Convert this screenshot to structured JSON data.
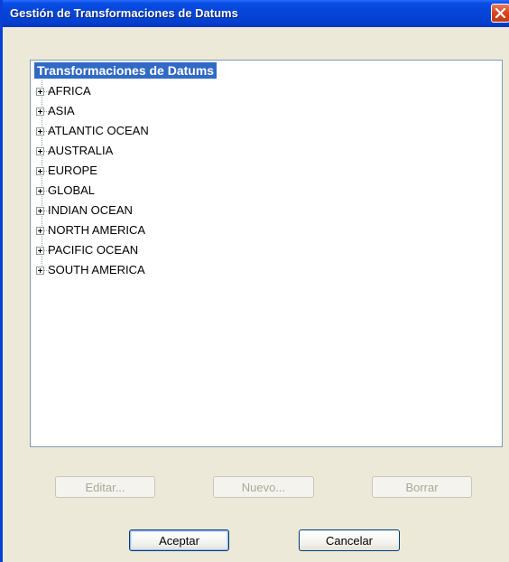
{
  "window": {
    "title": "Gestión de Transformaciones de Datums"
  },
  "tree": {
    "root_label": "Transformaciones de Datums",
    "items": [
      {
        "label": "AFRICA"
      },
      {
        "label": "ASIA"
      },
      {
        "label": "ATLANTIC OCEAN"
      },
      {
        "label": "AUSTRALIA"
      },
      {
        "label": "EUROPE"
      },
      {
        "label": "GLOBAL"
      },
      {
        "label": "INDIAN OCEAN"
      },
      {
        "label": "NORTH AMERICA"
      },
      {
        "label": "PACIFIC OCEAN"
      },
      {
        "label": "SOUTH AMERICA"
      }
    ]
  },
  "actions": {
    "edit_label": "Editar...",
    "new_label": "Nuevo...",
    "delete_label": "Borrar"
  },
  "footer": {
    "accept_label": "Aceptar",
    "cancel_label": "Cancelar"
  },
  "icons": {
    "close": "close-icon",
    "expand": "plus-box-icon"
  }
}
